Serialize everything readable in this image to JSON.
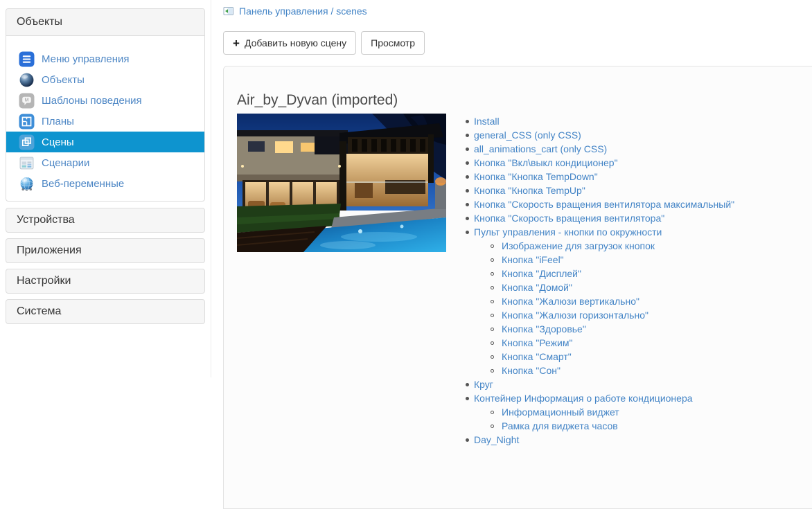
{
  "sidebar": {
    "objects_panel_title": "Объекты",
    "menu_items": [
      {
        "id": "control-menu",
        "icon": "menu-icon",
        "label": "Меню управления",
        "active": false
      },
      {
        "id": "objects",
        "icon": "sphere-icon",
        "label": "Объекты",
        "active": false
      },
      {
        "id": "behavior-templates",
        "icon": "behavior-templates-icon",
        "label": "Шаблоны поведения",
        "active": false
      },
      {
        "id": "plans",
        "icon": "plans-icon",
        "label": "Планы",
        "active": false
      },
      {
        "id": "scenes",
        "icon": "scenes-icon",
        "label": "Сцены",
        "active": true
      },
      {
        "id": "scenarios",
        "icon": "scenarios-icon",
        "label": "Сценарии",
        "active": false
      },
      {
        "id": "web-variables",
        "icon": "web-variables-icon",
        "label": "Веб-переменные",
        "active": false
      }
    ],
    "collapsed_panels": [
      {
        "id": "devices",
        "label": "Устройства"
      },
      {
        "id": "apps",
        "label": "Приложения"
      },
      {
        "id": "settings",
        "label": "Настройки"
      },
      {
        "id": "system",
        "label": "Система"
      }
    ]
  },
  "breadcrumb": {
    "icon": "panel-window-icon",
    "label": "Панель управления / scenes"
  },
  "toolbar": {
    "plus": "+",
    "add_scene_label": "Добавить новую сцену",
    "view_label": "Просмотр"
  },
  "content": {
    "scene_title": "Air_by_Dyvan (imported)",
    "scene_image": "night-house-with-pool-photo",
    "elements": [
      {
        "label": "Install",
        "level": 1
      },
      {
        "label": "general_CSS (only CSS)",
        "level": 1
      },
      {
        "label": "all_animations_cart (only CSS)",
        "level": 1
      },
      {
        "label": "Кнопка \"Вкл\\выкл кондиционер\"",
        "level": 1
      },
      {
        "label": "Кнопка \"Кнопка TempDown\"",
        "level": 1
      },
      {
        "label": "Кнопка \"Кнопка TempUp\"",
        "level": 1
      },
      {
        "label": "Кнопка \"Скорость вращения вентилятора максимальный\"",
        "level": 1
      },
      {
        "label": "Кнопка \"Скорость вращения вентилятора\"",
        "level": 1
      },
      {
        "label": "Пульт управления - кнопки по окружности",
        "level": 1
      },
      {
        "label": "Изображение для загрузок кнопок",
        "level": 2
      },
      {
        "label": "Кнопка \"iFeel\"",
        "level": 2
      },
      {
        "label": "Кнопка \"Дисплей\"",
        "level": 2
      },
      {
        "label": "Кнопка \"Домой\"",
        "level": 2
      },
      {
        "label": "Кнопка \"Жалюзи вертикально\"",
        "level": 2
      },
      {
        "label": "Кнопка \"Жалюзи горизонтально\"",
        "level": 2
      },
      {
        "label": "Кнопка \"Здоровье\"",
        "level": 2
      },
      {
        "label": "Кнопка \"Режим\"",
        "level": 2
      },
      {
        "label": "Кнопка \"Смарт\"",
        "level": 2
      },
      {
        "label": "Кнопка \"Сон\"",
        "level": 2
      },
      {
        "label": "Круг",
        "level": 1
      },
      {
        "label": "Контейнер Информация о работе кондиционера",
        "level": 1
      },
      {
        "label": "Информационный виджет",
        "level": 2
      },
      {
        "label": "Рамка для виджета часов",
        "level": 2
      },
      {
        "label": "Day_Night",
        "level": 1
      }
    ]
  },
  "colors": {
    "active_item_bg": "#0e94cf",
    "sidebar_link": "#4e87c5",
    "content_link": "#4384c6",
    "panel_heading_bg": "#f5f5f5",
    "border": "#dddddd"
  }
}
